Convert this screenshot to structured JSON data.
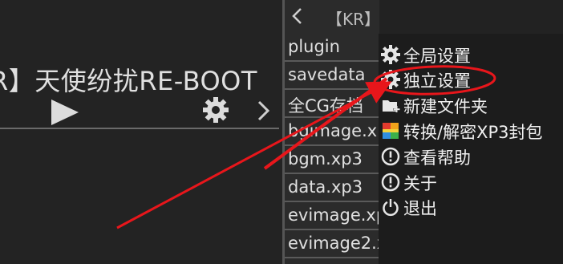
{
  "game": {
    "title": "R】天使纷扰RE-BOOT",
    "play_icon": "play-icon",
    "settings_icon": "gear-icon",
    "next_icon": "chevron-right-icon"
  },
  "file_list": {
    "header": "【KR】",
    "back_icon": "chevron-left-icon",
    "items": [
      "plugin",
      "savedata",
      "全CG存档",
      "bgimage.xp",
      "bgm.xp3",
      "data.xp3",
      "evimage.xp",
      "evimage2.x"
    ]
  },
  "menu": {
    "items": [
      {
        "label": "全局设置",
        "icon": "gear-icon"
      },
      {
        "label": "独立设置",
        "icon": "gear-icon"
      },
      {
        "label": "新建文件夹",
        "icon": "new-folder-icon"
      },
      {
        "label": "转换/解密XP3封包",
        "icon": "convert-icon"
      },
      {
        "label": "查看帮助",
        "icon": "info-icon"
      },
      {
        "label": "关于",
        "icon": "info-icon"
      },
      {
        "label": "退出",
        "icon": "power-icon"
      }
    ]
  },
  "annotation": {
    "color": "#e8161b"
  }
}
